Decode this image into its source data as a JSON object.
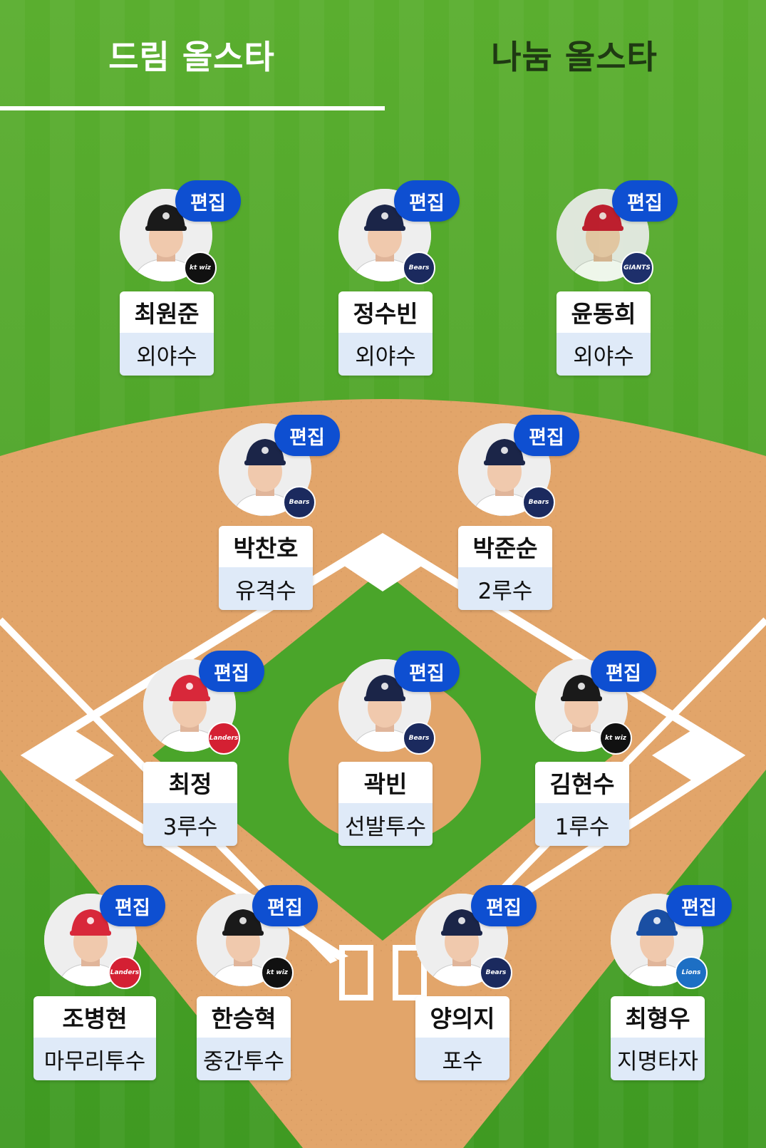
{
  "tabs": [
    {
      "label": "드림 올스타",
      "active": true
    },
    {
      "label": "나눔 올스타",
      "active": false
    }
  ],
  "edit_label": "편집",
  "colors": {
    "grass": "#4da52a",
    "dirt": "#e3a86b",
    "edit_button": "#0e4fd1",
    "position_bg": "#dfeaf8"
  },
  "players": [
    {
      "id": "rf",
      "name": "최원준",
      "position": "외야수",
      "team": "kt wiz",
      "team_icon": "kt-wiz-logo-icon",
      "cap": "kt"
    },
    {
      "id": "cf",
      "name": "정수빈",
      "position": "외야수",
      "team": "Bears",
      "team_icon": "bears-logo-icon",
      "cap": "bears"
    },
    {
      "id": "lf",
      "name": "윤동희",
      "position": "외야수",
      "team": "GIANTS",
      "team_icon": "giants-logo-icon",
      "cap": "giants"
    },
    {
      "id": "ss",
      "name": "박찬호",
      "position": "유격수",
      "team": "Bears",
      "team_icon": "bears-logo-icon",
      "cap": "bears"
    },
    {
      "id": "2b",
      "name": "박준순",
      "position": "2루수",
      "team": "Bears",
      "team_icon": "bears-logo-icon",
      "cap": "bears"
    },
    {
      "id": "3b",
      "name": "최정",
      "position": "3루수",
      "team": "Landers",
      "team_icon": "landers-logo-icon",
      "cap": "landers"
    },
    {
      "id": "sp",
      "name": "곽빈",
      "position": "선발투수",
      "team": "Bears",
      "team_icon": "bears-logo-icon",
      "cap": "bears"
    },
    {
      "id": "1b",
      "name": "김현수",
      "position": "1루수",
      "team": "kt wiz",
      "team_icon": "kt-wiz-logo-icon",
      "cap": "kt"
    },
    {
      "id": "cl",
      "name": "조병현",
      "position": "마무리투수",
      "team": "Landers",
      "team_icon": "landers-logo-icon",
      "cap": "landers"
    },
    {
      "id": "rp",
      "name": "한승혁",
      "position": "중간투수",
      "team": "kt wiz",
      "team_icon": "kt-wiz-logo-icon",
      "cap": "kt"
    },
    {
      "id": "c",
      "name": "양의지",
      "position": "포수",
      "team": "Bears",
      "team_icon": "bears-logo-icon",
      "cap": "bears"
    },
    {
      "id": "dh",
      "name": "최형우",
      "position": "지명타자",
      "team": "Lions",
      "team_icon": "lions-logo-icon",
      "cap": "lions"
    }
  ]
}
